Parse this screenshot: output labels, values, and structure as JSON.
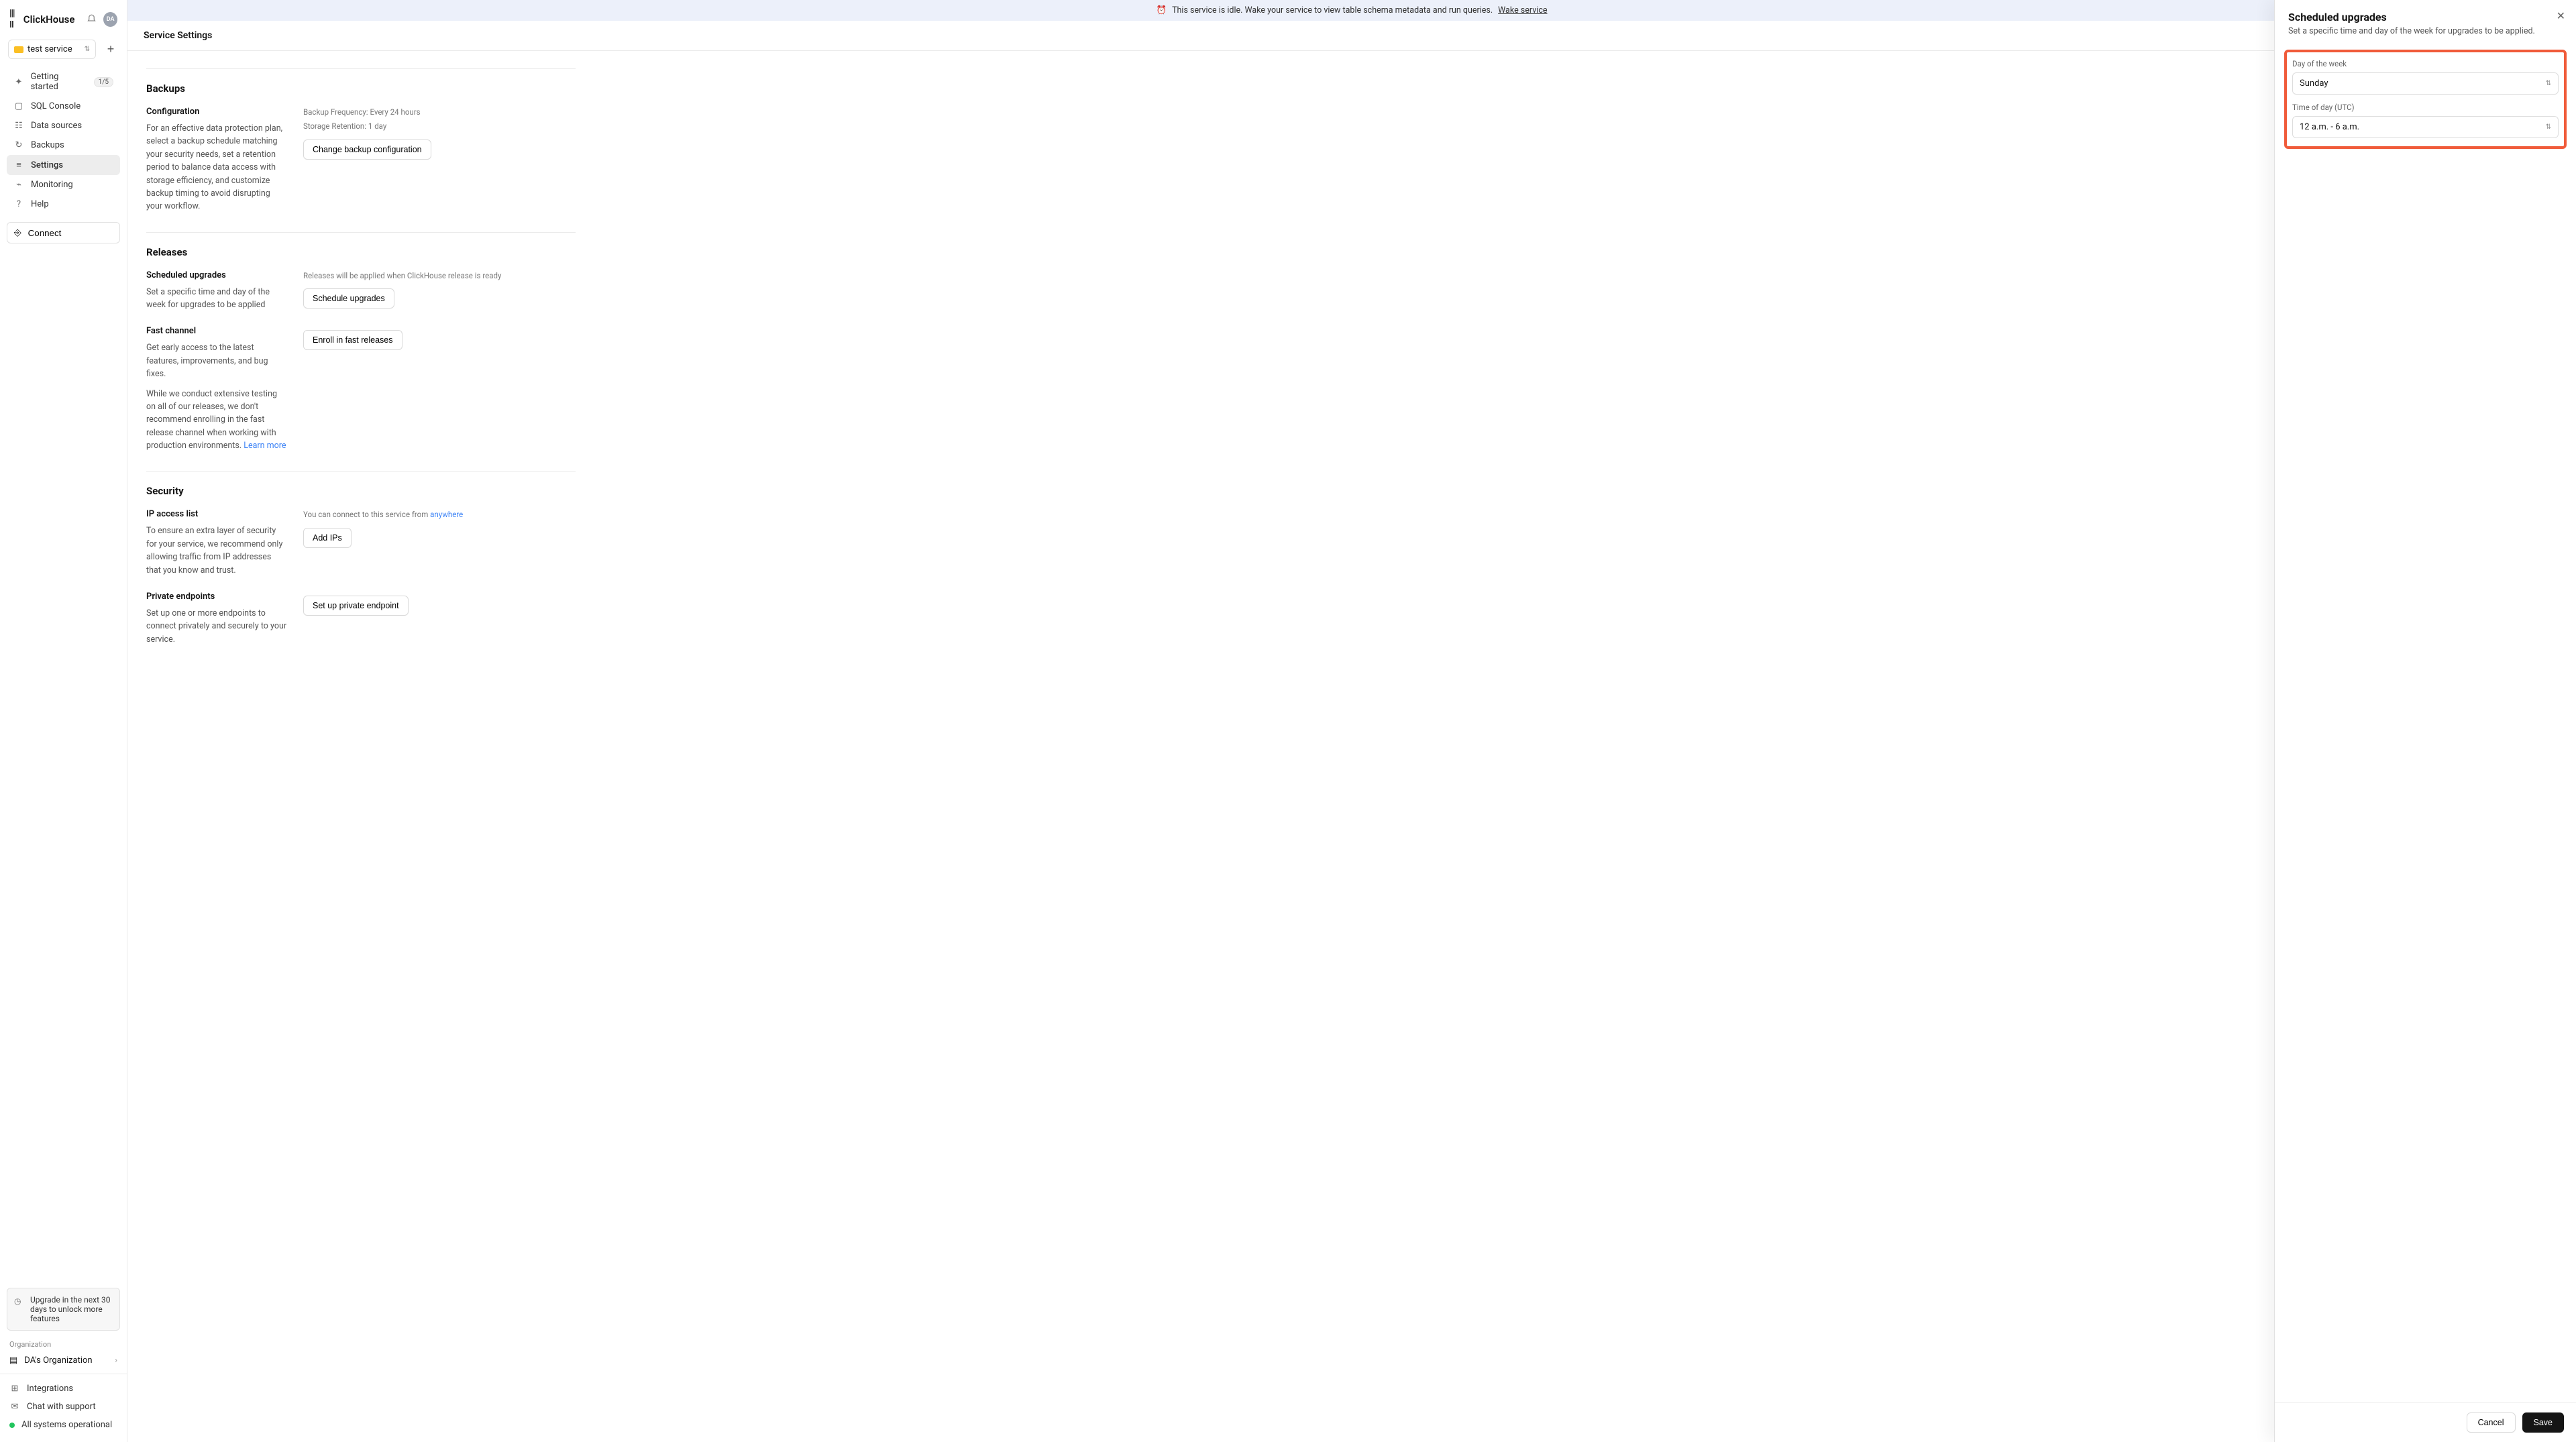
{
  "brand": "ClickHouse",
  "avatar_initials": "DA",
  "service_selector": {
    "name": "test service"
  },
  "nav": {
    "getting_started": "Getting started",
    "getting_started_badge": "1/5",
    "sql_console": "SQL Console",
    "data_sources": "Data sources",
    "backups": "Backups",
    "settings": "Settings",
    "monitoring": "Monitoring",
    "help": "Help",
    "connect": "Connect"
  },
  "upgrade_card": "Upgrade in the next 30 days to unlock more features",
  "org": {
    "label": "Organization",
    "name": "DA's Organization"
  },
  "footer": {
    "integrations": "Integrations",
    "chat": "Chat with support",
    "status": "All systems operational"
  },
  "banner": {
    "text": "This service is idle. Wake your service to view table schema metadata and run queries.",
    "link": "Wake service"
  },
  "page_title": "Service Settings",
  "sections": {
    "backups": {
      "title": "Backups",
      "configuration": {
        "heading": "Configuration",
        "desc": "For an effective data protection plan, select a backup schedule matching your security needs, set a retention period to balance data access with storage efficiency, and customize backup timing to avoid disrupting your workflow.",
        "meta1": "Backup Frequency: Every 24 hours",
        "meta2": "Storage Retention: 1 day",
        "button": "Change backup configuration"
      }
    },
    "releases": {
      "title": "Releases",
      "scheduled": {
        "heading": "Scheduled upgrades",
        "desc": "Set a specific time and day of the week for upgrades to be applied",
        "meta": "Releases will be applied when ClickHouse release is ready",
        "button": "Schedule upgrades"
      },
      "fast": {
        "heading": "Fast channel",
        "desc1": "Get early access to the latest features, improvements, and bug fixes.",
        "desc2": "While we conduct extensive testing on all of our releases, we don't recommend enrolling in the fast release channel when working with production environments. ",
        "learn_more": "Learn more",
        "button": "Enroll in fast releases"
      }
    },
    "security": {
      "title": "Security",
      "ip": {
        "heading": "IP access list",
        "desc": "To ensure an extra layer of security for your service, we recommend only allowing traffic from IP addresses that you know and trust.",
        "meta_prefix": "You can connect to this service from ",
        "meta_link": "anywhere",
        "button": "Add IPs"
      },
      "private": {
        "heading": "Private endpoints",
        "desc": "Set up one or more endpoints to connect privately and securely to your service.",
        "button": "Set up private endpoint"
      }
    }
  },
  "drawer": {
    "title": "Scheduled upgrades",
    "subtitle": "Set a specific time and day of the week for upgrades to be applied.",
    "day_label": "Day of the week",
    "day_value": "Sunday",
    "time_label": "Time of day (UTC)",
    "time_value": "12 a.m. - 6 a.m.",
    "cancel": "Cancel",
    "save": "Save"
  }
}
